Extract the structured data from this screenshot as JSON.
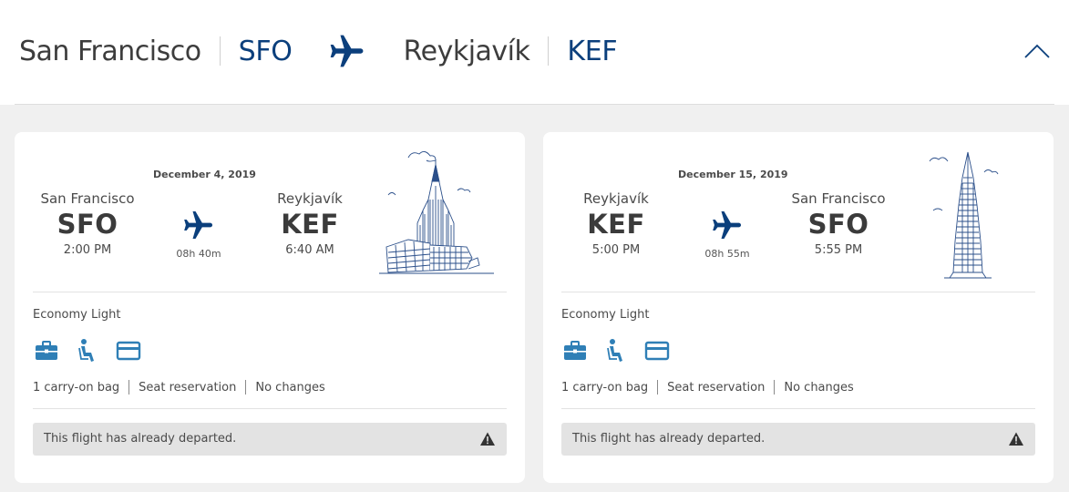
{
  "header": {
    "origin_city": "San Francisco",
    "origin_code": "SFO",
    "destination_city": "Reykjavík",
    "destination_code": "KEF",
    "plane_icon": "airplane-icon",
    "collapse_icon": "chevron-up-icon"
  },
  "colors": {
    "brand_blue": "#0b3f7c",
    "icon_blue": "#2f7fb6",
    "background": "#f0f0f0"
  },
  "flights": [
    {
      "date": "December 4, 2019",
      "depart_city": "San Francisco",
      "depart_code": "SFO",
      "depart_time": "2:00 PM",
      "arrive_city": "Reykjavík",
      "arrive_code": "KEF",
      "arrive_time": "6:40 AM",
      "duration": "08h 40m",
      "illustration": "hallgrimskirkja-illustration",
      "fare": "Economy Light",
      "feature_icons": [
        "briefcase-icon",
        "seat-icon",
        "credit-card-icon"
      ],
      "features": [
        "1 carry-on bag",
        "Seat reservation",
        "No changes"
      ],
      "notice": "This flight has already departed."
    },
    {
      "date": "December 15, 2019",
      "depart_city": "Reykjavík",
      "depart_code": "KEF",
      "depart_time": "5:00 PM",
      "arrive_city": "San Francisco",
      "arrive_code": "SFO",
      "arrive_time": "5:55 PM",
      "duration": "08h 55m",
      "illustration": "transamerica-pyramid-illustration",
      "fare": "Economy Light",
      "feature_icons": [
        "briefcase-icon",
        "seat-icon",
        "credit-card-icon"
      ],
      "features": [
        "1 carry-on bag",
        "Seat reservation",
        "No changes"
      ],
      "notice": "This flight has already departed."
    }
  ]
}
